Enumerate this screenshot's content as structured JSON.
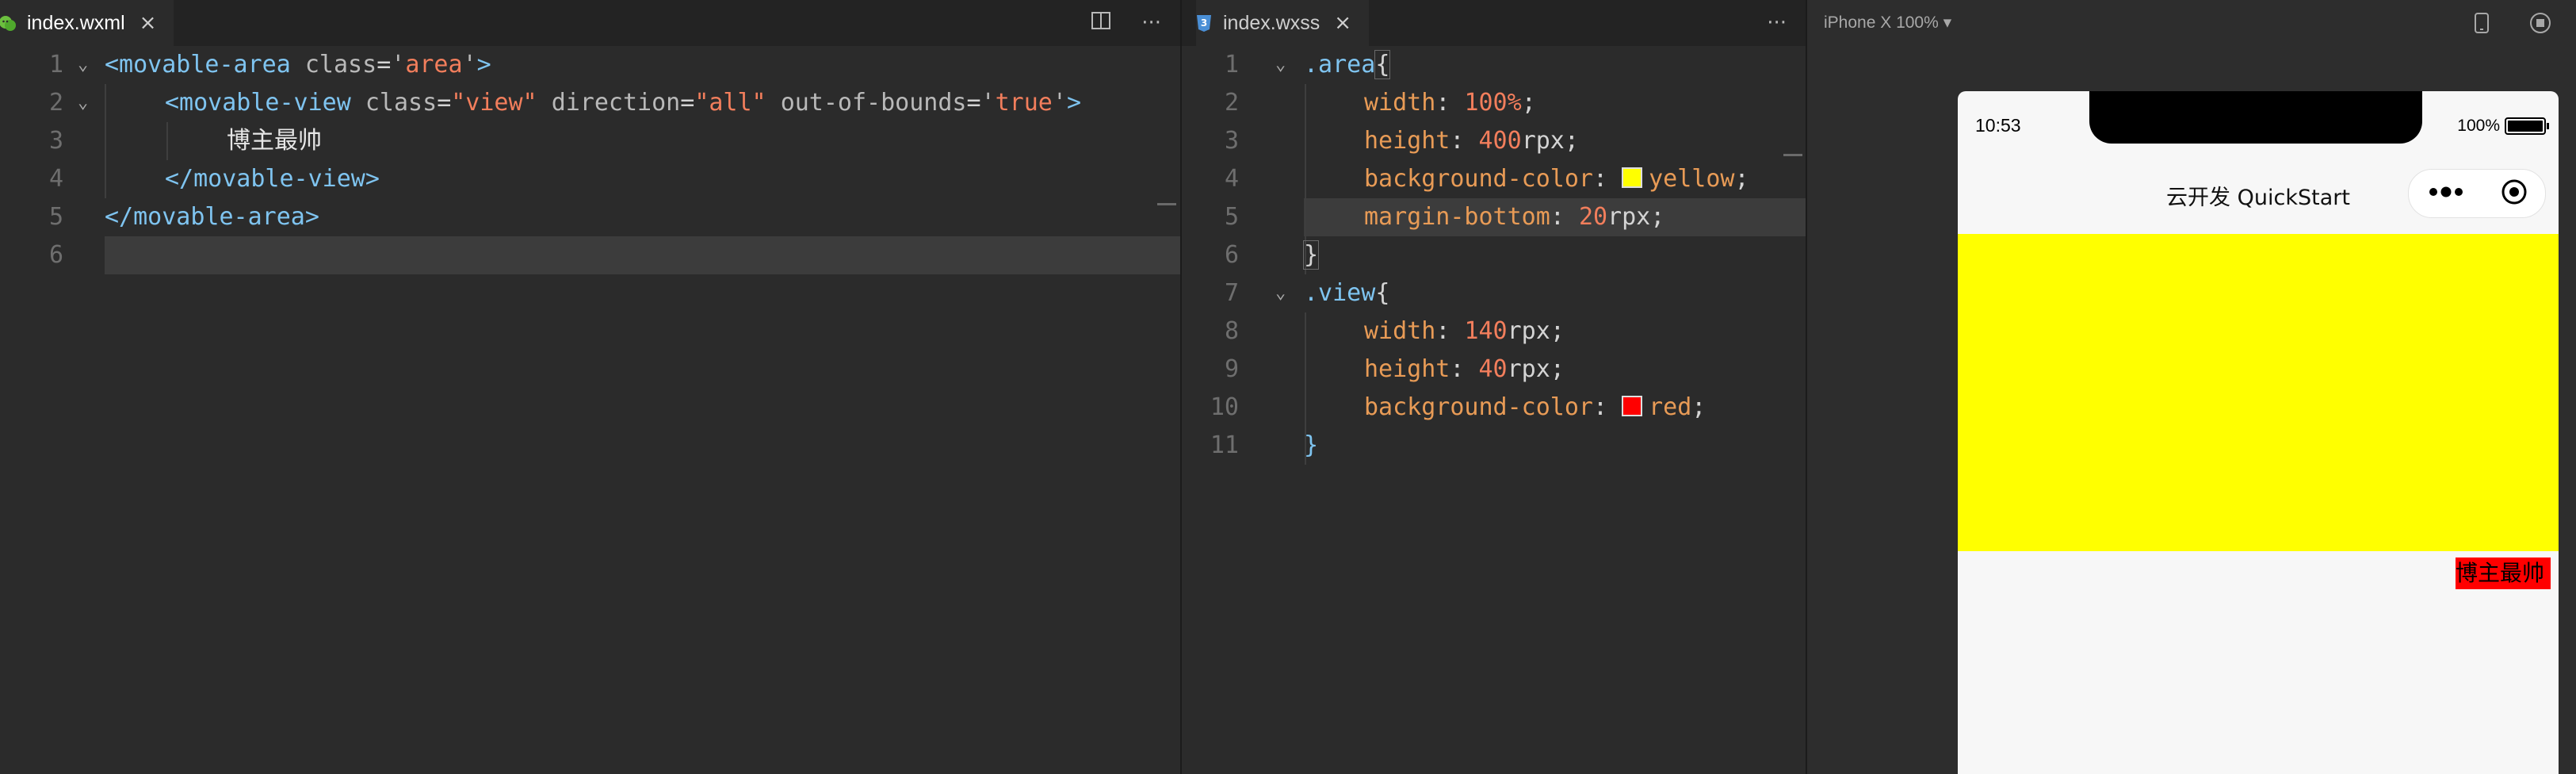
{
  "wxml": {
    "tab": {
      "filename": "index.wxml",
      "icon": "wechat-file-icon",
      "close": "×"
    },
    "actions": {
      "split": "split-editor-icon",
      "more": "···"
    },
    "line_numbers": [
      "1",
      "2",
      "3",
      "4",
      "5",
      "6"
    ],
    "lines": {
      "l1": {
        "open": "<movable-area",
        "attr": "class",
        "eq": "=",
        "q": "'",
        "val": "area",
        "close": ">"
      },
      "l2": {
        "open": "<movable-view",
        "attr1": "class",
        "val1": "\"view\"",
        "attr2": "direction",
        "val2": "\"all\"",
        "attr3": "out-of-bounds",
        "q": "'",
        "val3": "true",
        "close": ">"
      },
      "l3": {
        "text": "博主最帅"
      },
      "l4": {
        "close_tag": "</movable-view>"
      },
      "l5": {
        "close_tag": "</movable-area>"
      }
    }
  },
  "wxss": {
    "tab": {
      "filename": "index.wxss",
      "icon": "css-file-icon",
      "close": "×"
    },
    "actions": {
      "more": "···"
    },
    "line_numbers": [
      "1",
      "2",
      "3",
      "4",
      "5",
      "6",
      "7",
      "8",
      "9",
      "10",
      "11"
    ],
    "rules": {
      "area": {
        "selector": ".area",
        "open": "{",
        "close": "}",
        "width": {
          "prop": "width",
          "num": "100",
          "unit": "%"
        },
        "height": {
          "prop": "height",
          "num": "400",
          "unit": "rpx"
        },
        "bg": {
          "prop": "background-color",
          "value": "yellow",
          "color": "#ffff00"
        },
        "mb": {
          "prop": "margin-bottom",
          "num": "20",
          "unit": "rpx"
        }
      },
      "view": {
        "selector": ".view",
        "open": "{",
        "close": "}",
        "width": {
          "prop": "width",
          "num": "140",
          "unit": "rpx"
        },
        "height": {
          "prop": "height",
          "num": "40",
          "unit": "rpx"
        },
        "bg": {
          "prop": "background-color",
          "value": "red",
          "color": "#ff0000"
        }
      }
    }
  },
  "simulator": {
    "device": "iPhone X 100%",
    "dropdown_icon": "▾",
    "status": {
      "time": "10:53",
      "battery": "100%"
    },
    "nav_title": "云开发 QuickStart",
    "movable_view_text": "博主最帅",
    "colors": {
      "area": "#ffff00",
      "view": "#ff0000"
    }
  }
}
